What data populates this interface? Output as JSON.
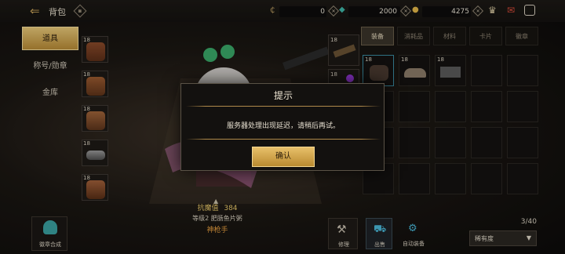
{
  "header": {
    "title": "背包"
  },
  "currencies": [
    {
      "value": "0"
    },
    {
      "value": "2000"
    },
    {
      "value": "4275"
    }
  ],
  "nav": {
    "items": [
      {
        "label": "道具"
      },
      {
        "label": "称号/勋章"
      },
      {
        "label": "金库"
      }
    ]
  },
  "inventory_slots": [
    {
      "level": "18"
    },
    {
      "level": "18"
    },
    {
      "level": "18"
    },
    {
      "level": "18"
    },
    {
      "level": "18"
    }
  ],
  "character": {
    "score_label": "抗魔值",
    "score": "384",
    "line": "等级2 肥肠鱼片粥",
    "class": "神枪手"
  },
  "tabs": [
    {
      "label": "装备"
    },
    {
      "label": "消耗品"
    },
    {
      "label": "材料"
    },
    {
      "label": "卡片"
    },
    {
      "label": "徽章"
    }
  ],
  "grid": {
    "cells_levels": [
      "18",
      "18",
      "18",
      "18"
    ],
    "count": "3/40",
    "sort": "稀有度"
  },
  "actions": {
    "compose": "徽章合成",
    "repair": "修理",
    "sell": "出售",
    "auto_equip": "自动装备"
  },
  "dialog": {
    "title": "提示",
    "message": "服务器处理出现延迟，请稍后再试。",
    "confirm": "确认"
  },
  "colors": {
    "gold": "#c9a45a",
    "panel": "#13110f"
  }
}
